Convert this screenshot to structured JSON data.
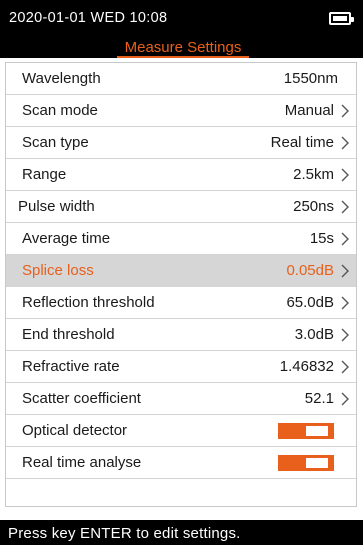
{
  "status_bar": {
    "datetime": "2020-01-01  WED  10:08",
    "battery_icon": "battery-full-icon"
  },
  "title": "Measure Settings",
  "colors": {
    "accent": "#e8601c",
    "selected_row_bg": "#d6d6d6",
    "header_bg": "#000000"
  },
  "settings": [
    {
      "label": "Wavelength",
      "value": "1550nm"
    },
    {
      "label": "Scan mode",
      "value": "Manual",
      "arrow_icon": "chevron-right-icon"
    },
    {
      "label": "Scan type",
      "value": "Real time",
      "arrow_icon": "chevron-right-icon"
    },
    {
      "label": "Range",
      "value": "2.5km",
      "arrow_icon": "chevron-right-icon"
    },
    {
      "label": "Pulse width",
      "value": "250ns",
      "arrow_icon": "chevron-right-icon"
    },
    {
      "label": "Average time",
      "value": "15s",
      "arrow_icon": "chevron-right-icon"
    },
    {
      "label": "Splice loss",
      "value": "0.05dB",
      "arrow_icon": "chevron-right-icon",
      "selected": true
    },
    {
      "label": "Reflection threshold",
      "value": "65.0dB",
      "arrow_icon": "chevron-right-icon"
    },
    {
      "label": "End threshold",
      "value": "3.0dB",
      "arrow_icon": "chevron-right-icon"
    },
    {
      "label": "Refractive rate",
      "value": "1.46832",
      "arrow_icon": "chevron-right-icon"
    },
    {
      "label": "Scatter coefficient",
      "value": "52.1",
      "arrow_icon": "chevron-right-icon"
    },
    {
      "label": "Optical detector",
      "toggle": "on"
    },
    {
      "label": "Real time analyse",
      "toggle": "on"
    }
  ],
  "footer": {
    "hint": "Press key ENTER to edit settings."
  }
}
